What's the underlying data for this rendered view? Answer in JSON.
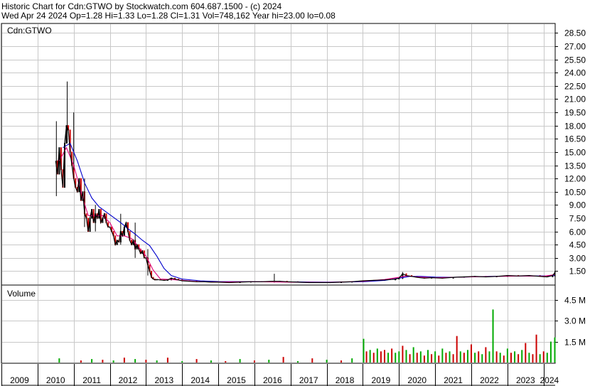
{
  "header": {
    "line1": "Historic Chart for Cdn:GTWO by Stockwatch.com 604.687.1500 - (c) 2024",
    "line2": "Wed Apr 24 2024   Op=1.28   Hi=1.33   Lo=1.28   Cl=1.31   Vol=748,162   Year hi=23.00   lo=0.08"
  },
  "colors": {
    "price": "#000000",
    "candle_down": "#cc0000",
    "ma_short": "#e0007a",
    "ma_long": "#0000cc",
    "vol_up": "#00aa00",
    "vol_down": "#cc0000",
    "grid": "#c8c8c8"
  },
  "chart_data": [
    {
      "type": "line",
      "title": "Cdn:GTWO",
      "ylim": [
        0,
        29.5
      ],
      "y_ticks": [
        1.5,
        3,
        4.5,
        6,
        7.5,
        9,
        10.5,
        12,
        13.5,
        15,
        16.5,
        18,
        19.5,
        21,
        22.5,
        24,
        25.5,
        27,
        28.5
      ],
      "y_tick_labels": [
        "1.50",
        "3.00",
        "4.50",
        "6.00",
        "7.50",
        "9.00",
        "10.50",
        "12.00",
        "13.50",
        "15.00",
        "16.50",
        "18.00",
        "19.50",
        "21.00",
        "22.50",
        "24.00",
        "25.50",
        "27.00",
        "28.50"
      ],
      "xlim": [
        2009.0,
        2024.32
      ],
      "grid": true,
      "series": [
        {
          "role": "close",
          "x": [
            2010.5,
            2010.55,
            2010.6,
            2010.65,
            2010.7,
            2010.75,
            2010.8,
            2010.85,
            2010.9,
            2010.95,
            2011.0,
            2011.05,
            2011.1,
            2011.15,
            2011.2,
            2011.25,
            2011.3,
            2011.35,
            2011.4,
            2011.45,
            2011.5,
            2011.55,
            2011.6,
            2011.65,
            2011.7,
            2011.75,
            2011.8,
            2011.85,
            2011.9,
            2011.95,
            2012.0,
            2012.05,
            2012.1,
            2012.15,
            2012.2,
            2012.25,
            2012.3,
            2012.35,
            2012.4,
            2012.45,
            2012.5,
            2012.55,
            2012.6,
            2012.65,
            2012.7,
            2012.75,
            2012.8,
            2012.85,
            2012.9,
            2012.95,
            2013.0,
            2013.05,
            2013.1,
            2013.15,
            2013.2,
            2013.25,
            2013.3,
            2013.4,
            2013.5,
            2013.6,
            2013.7,
            2013.8,
            2013.9,
            2014.0,
            2014.2,
            2014.4,
            2014.6,
            2014.8,
            2015.0,
            2015.3,
            2015.6,
            2015.9,
            2016.2,
            2016.5,
            2016.7,
            2016.9,
            2017.2,
            2017.5,
            2017.8,
            2018.1,
            2018.4,
            2018.7,
            2019.0,
            2019.3,
            2019.6,
            2019.9,
            2020.0,
            2020.1,
            2020.2,
            2020.35,
            2020.5,
            2020.7,
            2020.9,
            2021.2,
            2021.5,
            2021.8,
            2022.1,
            2022.4,
            2022.7,
            2023.0,
            2023.3,
            2023.6,
            2023.9,
            2024.1,
            2024.25,
            2024.31
          ],
          "values": [
            14.0,
            12.5,
            15.5,
            13.0,
            11.0,
            16.0,
            18.0,
            17.5,
            15.0,
            13.5,
            12.0,
            11.0,
            10.5,
            12.0,
            9.5,
            10.5,
            8.0,
            7.5,
            6.0,
            7.5,
            8.5,
            7.0,
            8.0,
            7.5,
            8.5,
            7.0,
            7.5,
            8.0,
            7.0,
            6.5,
            6.5,
            6.0,
            5.5,
            4.5,
            5.0,
            4.8,
            6.0,
            5.5,
            6.5,
            7.0,
            6.0,
            5.0,
            4.5,
            5.0,
            4.0,
            4.5,
            4.0,
            3.5,
            3.8,
            3.0,
            3.0,
            2.2,
            1.5,
            0.8,
            0.6,
            0.5,
            0.55,
            0.5,
            0.45,
            0.5,
            0.7,
            0.6,
            0.5,
            0.4,
            0.35,
            0.3,
            0.3,
            0.25,
            0.25,
            0.2,
            0.25,
            0.3,
            0.3,
            0.35,
            0.35,
            0.3,
            0.25,
            0.2,
            0.2,
            0.2,
            0.25,
            0.3,
            0.4,
            0.45,
            0.5,
            0.6,
            0.7,
            1.2,
            1.0,
            0.9,
            0.8,
            0.7,
            0.75,
            0.7,
            0.8,
            0.85,
            0.9,
            0.85,
            0.9,
            1.0,
            0.95,
            1.0,
            0.9,
            0.85,
            1.0,
            1.31
          ],
          "hl_range": [
            [
              2010.52,
              10.0,
              18.5
            ],
            [
              2010.82,
              16.0,
              23.0
            ],
            [
              2011.0,
              13.0,
              19.5
            ],
            [
              2011.3,
              6.5,
              12.0
            ],
            [
              2011.6,
              6.0,
              9.0
            ],
            [
              2012.3,
              4.5,
              8.0
            ],
            [
              2012.7,
              3.0,
              7.0
            ],
            [
              2013.05,
              1.0,
              4.0
            ],
            [
              2016.55,
              0.2,
              1.2
            ],
            [
              2020.1,
              0.6,
              1.4
            ],
            [
              2024.31,
              0.9,
              1.5
            ]
          ]
        },
        {
          "role": "ma-short",
          "x": [
            2010.6,
            2010.8,
            2011.0,
            2011.2,
            2011.4,
            2011.6,
            2011.8,
            2012.0,
            2012.2,
            2012.4,
            2012.6,
            2012.8,
            2013.0,
            2013.2,
            2013.4,
            2013.7,
            2014.0,
            2014.5,
            2015.0,
            2016.0,
            2017.0,
            2018.0,
            2019.0,
            2019.6,
            2020.0,
            2020.2,
            2020.5,
            2021.0,
            2021.5,
            2022.0,
            2022.5,
            2023.0,
            2023.5,
            2024.0,
            2024.3
          ],
          "values": [
            14.0,
            15.5,
            13.5,
            10.5,
            7.8,
            7.8,
            7.8,
            7.0,
            5.5,
            5.5,
            5.2,
            4.2,
            3.2,
            1.6,
            0.6,
            0.55,
            0.45,
            0.3,
            0.27,
            0.3,
            0.25,
            0.22,
            0.35,
            0.55,
            0.8,
            0.95,
            0.85,
            0.75,
            0.8,
            0.85,
            0.88,
            0.92,
            0.95,
            0.92,
            1.1
          ]
        },
        {
          "role": "ma-long",
          "x": [
            2010.7,
            2010.9,
            2011.1,
            2011.3,
            2011.5,
            2011.7,
            2011.9,
            2012.1,
            2012.3,
            2012.5,
            2012.7,
            2012.9,
            2013.1,
            2013.3,
            2013.5,
            2013.7,
            2014.0,
            2014.5,
            2015.0,
            2016.0,
            2017.0,
            2018.0,
            2019.0,
            2019.6,
            2020.0,
            2020.3,
            2020.6,
            2021.0,
            2021.5,
            2022.0,
            2022.5,
            2023.0,
            2023.5,
            2024.0,
            2024.3
          ],
          "values": [
            15.5,
            16.0,
            14.0,
            11.5,
            9.8,
            8.8,
            8.2,
            7.6,
            7.0,
            6.3,
            5.7,
            5.0,
            4.4,
            3.2,
            1.8,
            1.0,
            0.6,
            0.4,
            0.32,
            0.3,
            0.28,
            0.25,
            0.3,
            0.45,
            0.7,
            0.9,
            0.9,
            0.82,
            0.8,
            0.85,
            0.9,
            0.93,
            0.95,
            0.95,
            1.0
          ]
        }
      ]
    },
    {
      "type": "bar",
      "title": "Volume",
      "ylim": [
        0,
        5500000
      ],
      "y_ticks": [
        1500000,
        3000000,
        4500000
      ],
      "y_tick_labels": [
        "1.5 M",
        "3.0 M",
        "4.5 M"
      ],
      "xlim": [
        2009.0,
        2024.32
      ],
      "x_tick_labels": [
        "2009",
        "2010",
        "2011",
        "2012",
        "2013",
        "2014",
        "2015",
        "2016",
        "2017",
        "2018",
        "2019",
        "2020",
        "2021",
        "2022",
        "2023",
        "2024"
      ],
      "x_ticks": [
        2009.0,
        2010.0,
        2011.0,
        2012.0,
        2013.0,
        2014.0,
        2015.0,
        2016.0,
        2017.0,
        2018.0,
        2019.0,
        2020.0,
        2021.0,
        2022.0,
        2023.0,
        2024.0
      ],
      "x": [
        2010.6,
        2011.2,
        2011.5,
        2011.8,
        2012.1,
        2012.4,
        2012.7,
        2013.0,
        2013.3,
        2013.6,
        2014.0,
        2014.4,
        2014.8,
        2015.2,
        2015.6,
        2016.0,
        2016.4,
        2016.8,
        2017.2,
        2017.6,
        2018.0,
        2018.4,
        2018.7,
        2019.02,
        2019.1,
        2019.2,
        2019.3,
        2019.4,
        2019.5,
        2019.6,
        2019.7,
        2019.8,
        2019.9,
        2020.0,
        2020.1,
        2020.2,
        2020.3,
        2020.4,
        2020.5,
        2020.6,
        2020.7,
        2020.8,
        2020.9,
        2021.0,
        2021.1,
        2021.2,
        2021.3,
        2021.4,
        2021.5,
        2021.6,
        2021.7,
        2021.8,
        2021.9,
        2022.0,
        2022.1,
        2022.2,
        2022.3,
        2022.4,
        2022.5,
        2022.6,
        2022.7,
        2022.8,
        2022.9,
        2023.0,
        2023.1,
        2023.2,
        2023.3,
        2023.4,
        2023.5,
        2023.6,
        2023.7,
        2023.8,
        2023.9,
        2024.0,
        2024.1,
        2024.2,
        2024.31
      ],
      "values": [
        300000,
        150000,
        250000,
        200000,
        150000,
        350000,
        250000,
        200000,
        150000,
        350000,
        100000,
        250000,
        150000,
        100000,
        250000,
        150000,
        200000,
        400000,
        100000,
        300000,
        200000,
        150000,
        300000,
        1700000,
        800000,
        900000,
        700000,
        1000000,
        800000,
        900000,
        700000,
        1000000,
        700000,
        800000,
        1200000,
        900000,
        600000,
        1100000,
        700000,
        800000,
        500000,
        900000,
        600000,
        800000,
        500000,
        1000000,
        700000,
        800000,
        600000,
        1900000,
        800000,
        700000,
        900000,
        1300000,
        700000,
        800000,
        600000,
        1100000,
        800000,
        3800000,
        800000,
        700000,
        500000,
        1000000,
        700000,
        800000,
        600000,
        900000,
        1400000,
        700000,
        600000,
        2000000,
        600000,
        800000,
        700000,
        1500000,
        1800000
      ],
      "colors": [
        "up",
        "down",
        "up",
        "down",
        "up",
        "down",
        "up",
        "down",
        "up",
        "down",
        "up",
        "down",
        "up",
        "down",
        "up",
        "down",
        "up",
        "down",
        "up",
        "down",
        "up",
        "down",
        "up",
        "up",
        "down",
        "up",
        "down",
        "up",
        "down",
        "down",
        "up",
        "down",
        "up",
        "up",
        "down",
        "up",
        "down",
        "up",
        "down",
        "up",
        "down",
        "up",
        "down",
        "up",
        "down",
        "up",
        "down",
        "up",
        "down",
        "down",
        "up",
        "down",
        "up",
        "down",
        "up",
        "down",
        "up",
        "down",
        "up",
        "up",
        "down",
        "up",
        "down",
        "up",
        "down",
        "up",
        "down",
        "up",
        "down",
        "up",
        "down",
        "down",
        "up",
        "down",
        "up",
        "up",
        "up"
      ]
    }
  ]
}
